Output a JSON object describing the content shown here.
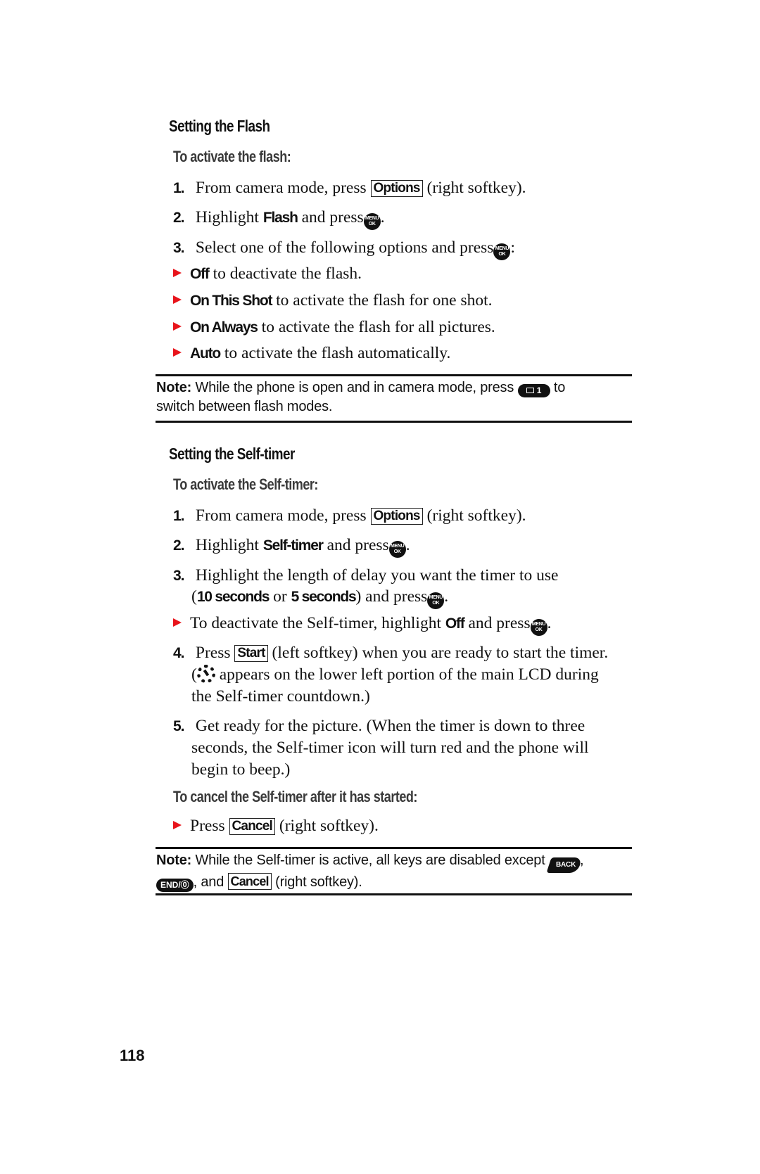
{
  "page_number": "118",
  "accent_color": "#e8141b",
  "sections": {
    "flash": {
      "heading": "Setting the Flash",
      "subheading": "To activate the flash:",
      "steps": [
        {
          "num": "1.",
          "pre": "From camera mode, press",
          "key": "Options",
          "post": "(right softkey)."
        },
        {
          "num": "2.",
          "pre": "Highlight",
          "bold": "Flash",
          "post": "and press",
          "icon": "menu-ok-key",
          "end": "."
        },
        {
          "num": "3.",
          "pre": "Select one of the following options and press",
          "icon": "menu-ok-key",
          "end": ":"
        }
      ],
      "options": [
        {
          "bold": "Off",
          "text": "to deactivate the flash."
        },
        {
          "bold": "On This Shot",
          "text": "to activate the flash for one shot."
        },
        {
          "bold": "On Always",
          "text": "to activate the flash for all pictures."
        },
        {
          "bold": "Auto",
          "text": "to activate the flash automatically."
        }
      ],
      "note": {
        "label": "Note:",
        "text_before": "While the phone is open and in camera mode, press",
        "key_label": "1",
        "key_icon": "envelope-icon",
        "text_after": "to",
        "line2": "switch between flash modes."
      }
    },
    "selftimer": {
      "heading": "Setting the Self-timer",
      "subheading": "To activate the Self-timer:",
      "steps": [
        {
          "num": "1.",
          "pre": "From camera mode, press",
          "key": "Options",
          "post": "(right softkey)."
        },
        {
          "num": "2.",
          "pre": "Highlight",
          "bold": "Self-timer",
          "post": "and press",
          "end": "."
        },
        {
          "num": "3.",
          "line1": "Highlight the length of delay you want the timer to use",
          "open": "(",
          "bold1": "10 seconds",
          "or": "or",
          "bold2": "5 seconds",
          "close": ") and press",
          "end": "."
        },
        {
          "num": "4.",
          "pre": "Press",
          "key": "Start",
          "post": "(left softkey) when you are ready to start the timer.",
          "line2_open": "(",
          "line2": "appears on the lower left portion of the main LCD during",
          "line3": "the Self-timer countdown.)"
        },
        {
          "num": "5.",
          "line1": "Get ready for the picture. (When the timer is down to three",
          "line2": "seconds, the Self-timer icon will turn red and the phone will",
          "line3": "begin to beep.)"
        }
      ],
      "deactivate_bullet": {
        "pre": "To deactivate the Self-timer, highlight",
        "bold": "Off",
        "post": "and press",
        "end": "."
      },
      "cancel_subheading": "To cancel the Self-timer after it has started:",
      "cancel_bullet": {
        "pre": "Press",
        "key": "Cancel",
        "post": "(right softkey)."
      },
      "note": {
        "label": "Note:",
        "text_before": "While the Self-timer is active, all keys are disabled except",
        "back_key": "BACK",
        "comma": ",",
        "end_key": "END/⓪",
        "text_mid": ", and",
        "key": "Cancel",
        "text_after": "(right softkey)."
      }
    }
  },
  "menu_ok_label": {
    "top": "MENU",
    "bottom": "OK"
  }
}
